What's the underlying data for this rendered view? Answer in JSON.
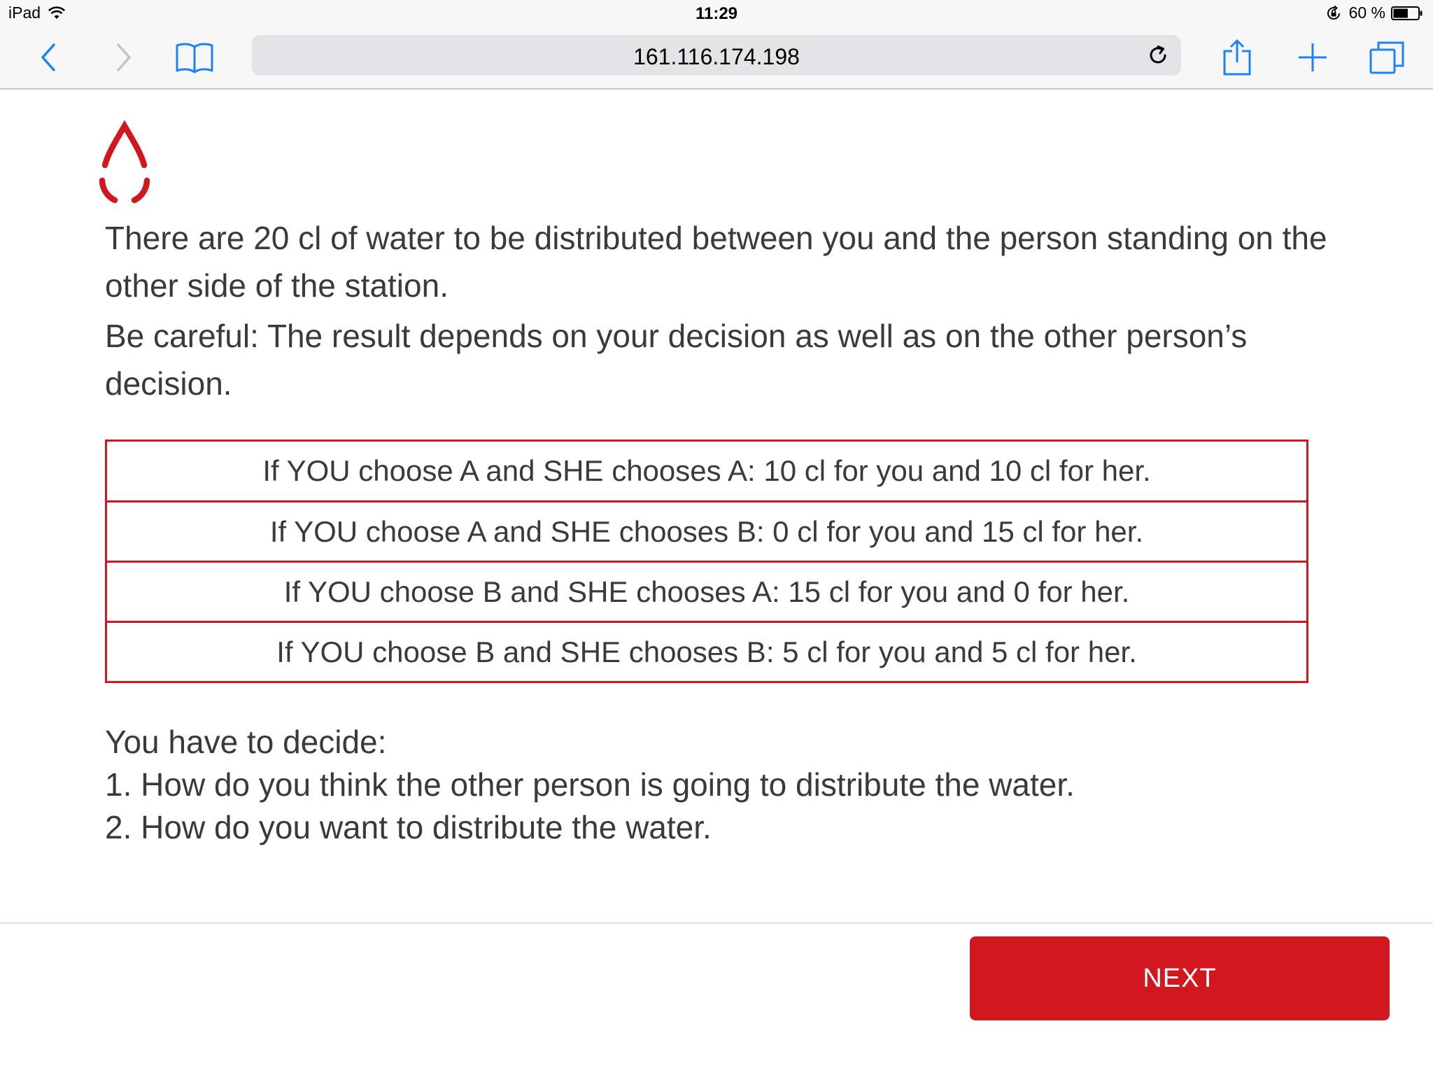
{
  "status_bar": {
    "device": "iPad",
    "time": "11:29",
    "battery": "60 %",
    "battery_level": 0.6
  },
  "browser": {
    "url": "161.116.174.198",
    "icons": [
      "back-icon",
      "forward-icon",
      "bookmarks-icon",
      "reload-icon",
      "share-icon",
      "add-tab-icon",
      "tabs-icon"
    ]
  },
  "colors": {
    "accent": "#d0181e",
    "ios_blue": "#1a82fb",
    "text": "#3a3a3a"
  },
  "content": {
    "intro": [
      "There are 20 cl of water to be distributed between you and the person standing on the other side of the station.",
      "Be careful: The result depends on your decision as well as on the other person’s decision."
    ],
    "payoffs": [
      "If YOU choose A and SHE chooses A: 10 cl for you and 10 cl for her.",
      "If YOU choose A and SHE chooses B: 0 cl for you and 15 cl for her.",
      "If YOU choose B and SHE chooses A: 15 cl for you and 0 for her.",
      "If YOU choose B and SHE chooses B: 5 cl for you and 5 cl for her."
    ],
    "decide": [
      "You have to decide:",
      "1. How do you think the other person is going to distribute the water.",
      "2. How do you want to distribute the water."
    ]
  },
  "footer": {
    "next_label": "NEXT"
  }
}
